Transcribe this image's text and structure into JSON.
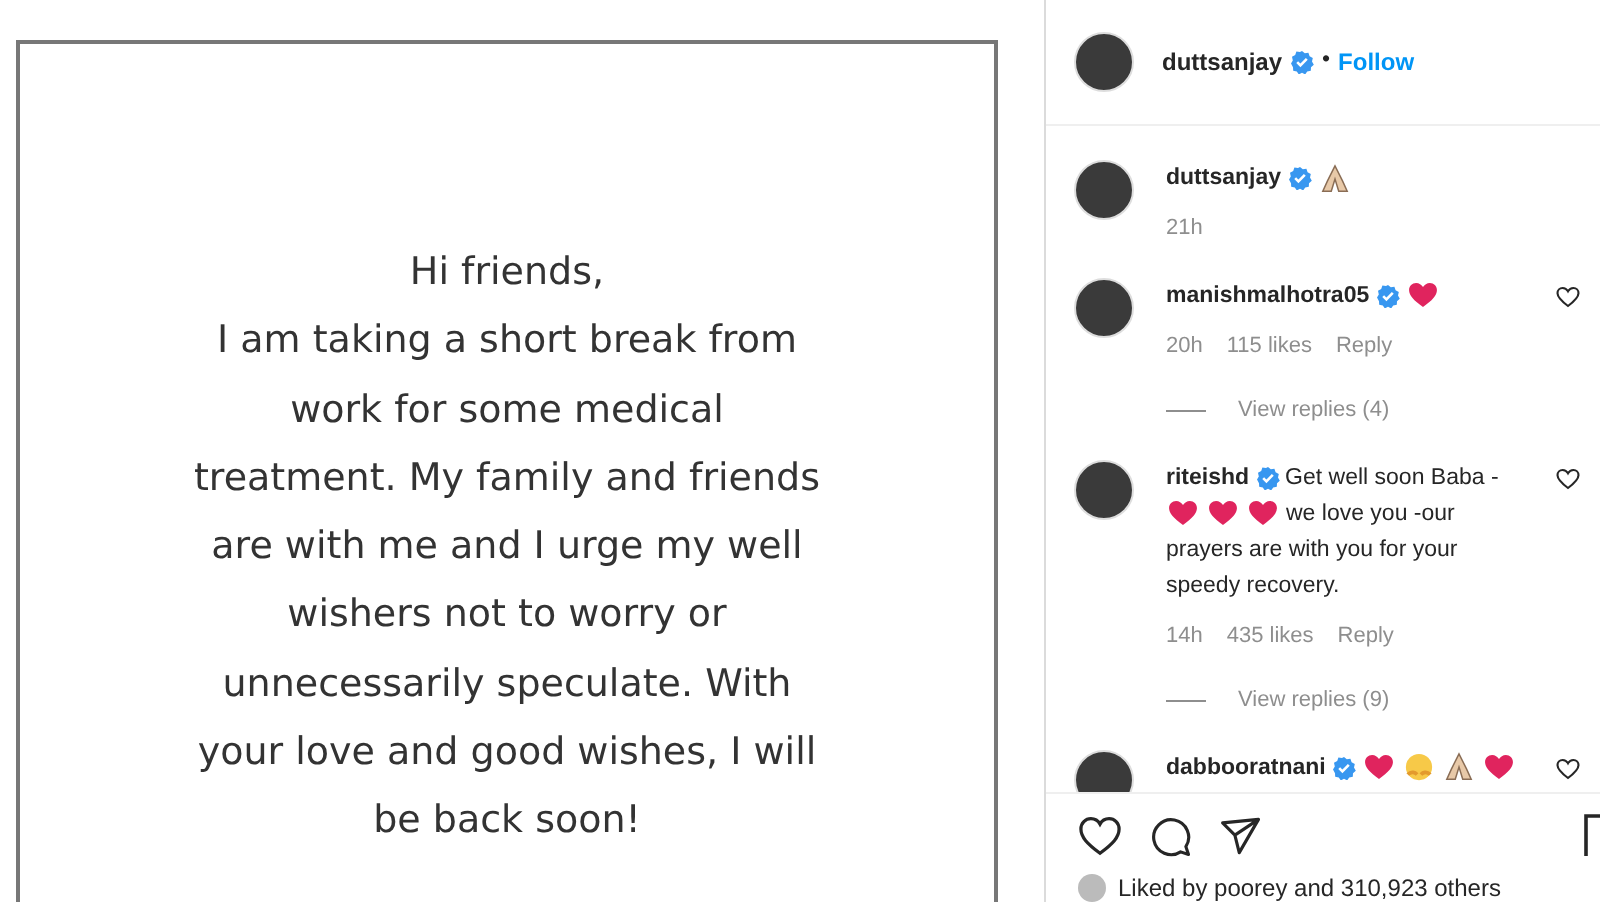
{
  "post_image": {
    "lines": [
      "Hi friends,",
      "I am taking a short break from",
      "work for some medical",
      "treatment. My family and friends",
      "are with me and I urge my well",
      "wishers not to worry or",
      "unnecessarily speculate. With",
      "your love and good wishes, I will",
      "be back soon!"
    ]
  },
  "header": {
    "username": "duttsanjay",
    "verified": true,
    "separator": "•",
    "follow": "Follow"
  },
  "comments": [
    {
      "username": "duttsanjay",
      "verified": true,
      "lines": [
        [
          {
            "kind": "pray"
          }
        ]
      ],
      "time": "21h",
      "like_button": false
    },
    {
      "username": "manishmalhotra05",
      "verified": true,
      "lines": [
        [
          {
            "kind": "heart"
          }
        ]
      ],
      "time": "20h",
      "likes": "115 likes",
      "reply": "Reply",
      "view_replies": "View replies (4)",
      "like_button": true
    },
    {
      "username": "riteishd",
      "verified": true,
      "lines": [
        [
          {
            "kind": "text",
            "text": "Get well soon Baba -"
          }
        ],
        [
          {
            "kind": "heart"
          },
          {
            "kind": "heart"
          },
          {
            "kind": "heart"
          },
          {
            "kind": "text",
            "text": "we love you -our"
          }
        ],
        [
          {
            "kind": "text",
            "text": "prayers are with you for your"
          }
        ],
        [
          {
            "kind": "text",
            "text": "speedy recovery."
          }
        ]
      ],
      "time": "14h",
      "likes": "435 likes",
      "reply": "Reply",
      "view_replies": "View replies (9)",
      "like_button": true
    },
    {
      "username": "dabbooratnani",
      "verified": true,
      "lines": [
        [
          {
            "kind": "heart"
          },
          {
            "kind": "hug"
          },
          {
            "kind": "pray"
          },
          {
            "kind": "heart"
          }
        ]
      ],
      "like_button": true
    }
  ],
  "liked_by": "Liked by poorey and 310,923 others"
}
